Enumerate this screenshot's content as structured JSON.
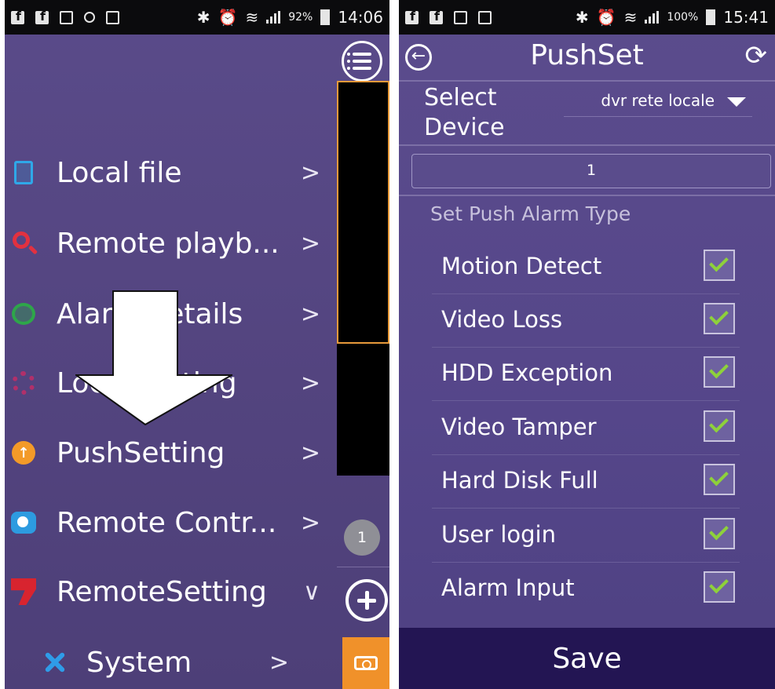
{
  "left_screen": {
    "status": {
      "battery": "92%",
      "time": "14:06"
    },
    "menu_items": [
      {
        "label": "Local file",
        "chev": ">"
      },
      {
        "label": "Remote playb...",
        "chev": ">"
      },
      {
        "label": "Alarm details",
        "chev": ">"
      },
      {
        "label": "Local setting",
        "chev": ">"
      },
      {
        "label": "PushSetting",
        "chev": ">"
      },
      {
        "label": "Remote Contr...",
        "chev": ">"
      },
      {
        "label": "RemoteSetting",
        "chev": "∨"
      },
      {
        "label": "System",
        "chev": ">"
      }
    ],
    "count_badge": "1",
    "colors": {
      "push_icon": "#f39a28",
      "camera_button": "#f0912a",
      "video_border": "#e89a3a"
    }
  },
  "right_screen": {
    "status": {
      "battery": "100%",
      "time": "15:41"
    },
    "title": "PushSet",
    "select_device_label": "Select Device",
    "device_value": "dvr rete locale",
    "channel_value": "1",
    "section_heading": "Set Push Alarm Type",
    "alarm_types": [
      {
        "label": "Motion Detect",
        "checked": true
      },
      {
        "label": "Video Loss",
        "checked": true
      },
      {
        "label": "HDD Exception",
        "checked": true
      },
      {
        "label": "Video Tamper",
        "checked": true
      },
      {
        "label": "Hard Disk Full",
        "checked": true
      },
      {
        "label": "User login",
        "checked": true
      },
      {
        "label": "Alarm Input",
        "checked": true
      }
    ],
    "save_label": "Save",
    "colors": {
      "background": "#55468a",
      "save_bar": "#231553",
      "check": "#8ed13b"
    }
  }
}
